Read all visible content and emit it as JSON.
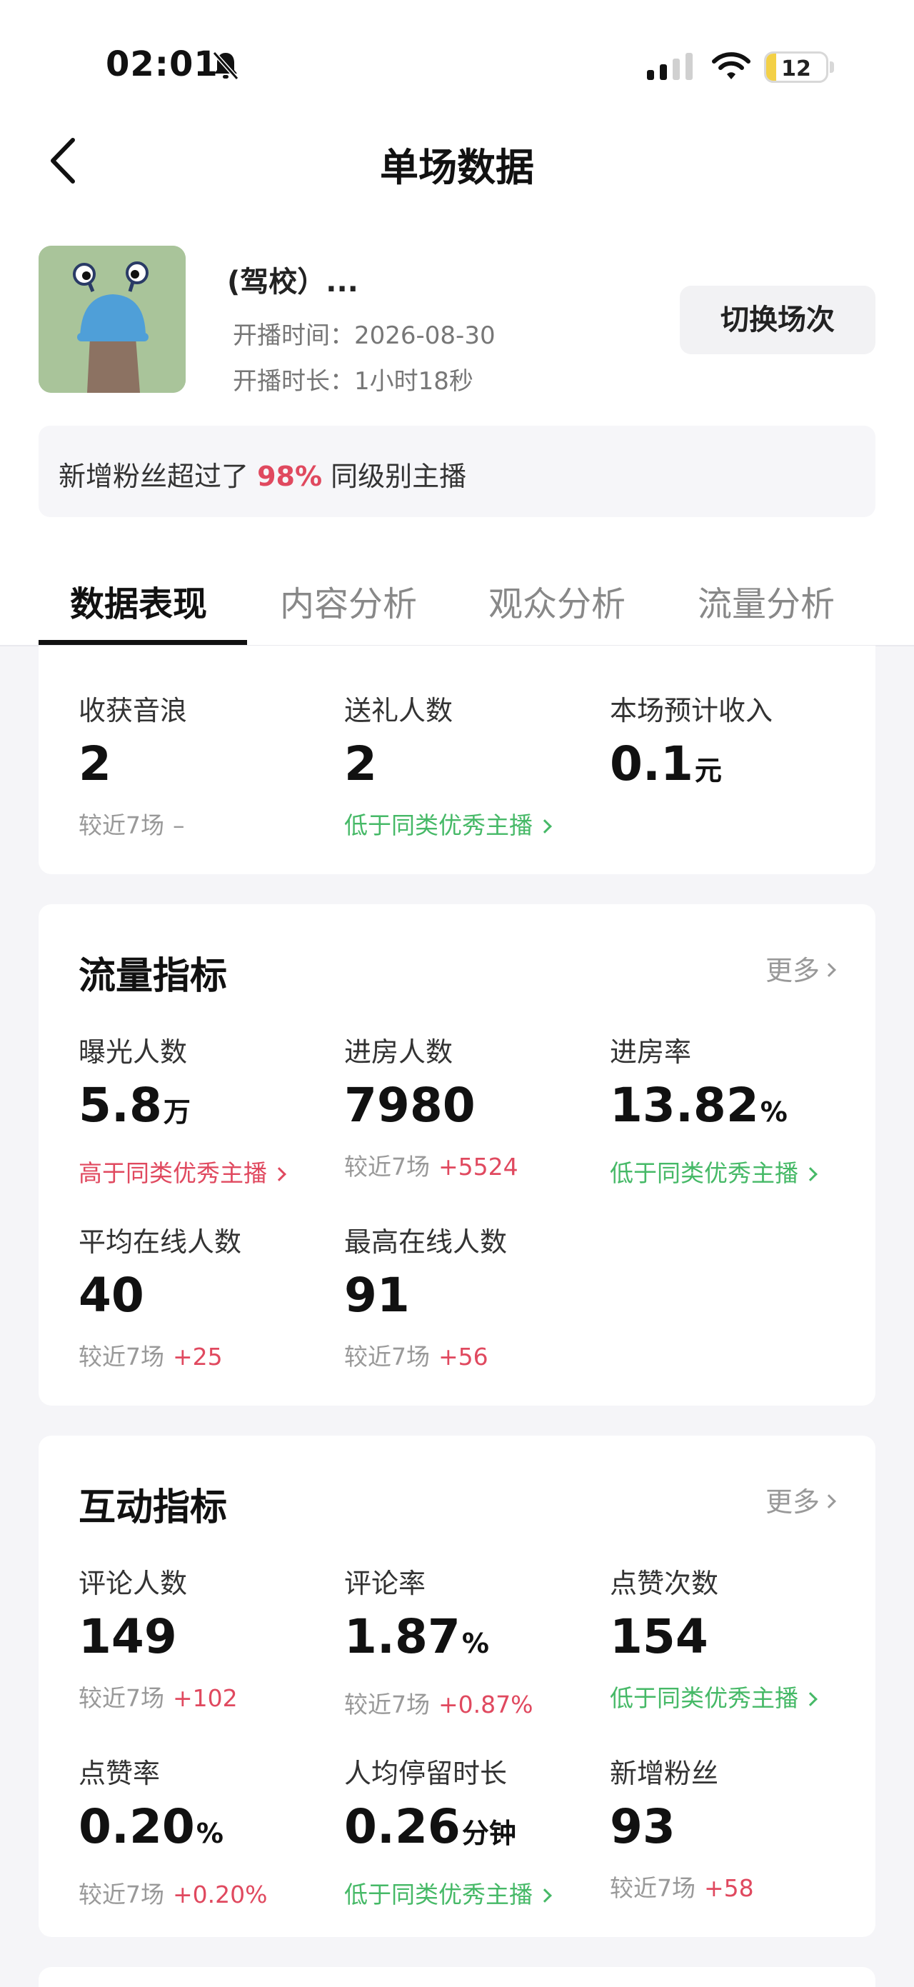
{
  "status_bar": {
    "time": "02:01",
    "battery": "12"
  },
  "header": {
    "title": "单场数据"
  },
  "room": {
    "name": "(驾校）...",
    "start_time_label": "开播时间：",
    "start_time_value": "2026-08-30",
    "duration_label": "开播时长：",
    "duration_value": "1小时18秒",
    "switch_button": "切换场次"
  },
  "banner": {
    "prefix": "新增粉丝超过了",
    "percent": "98%",
    "suffix": "同级别主播"
  },
  "tabs": [
    "数据表现",
    "内容分析",
    "观众分析",
    "流量分析"
  ],
  "summary": {
    "items": [
      {
        "label": "收获音浪",
        "value": "2",
        "unit": "",
        "sub": "较近7场",
        "delta": "–"
      },
      {
        "label": "送礼人数",
        "value": "2",
        "unit": "",
        "sub": "低于同类优秀主播"
      },
      {
        "label": "本场预计收入",
        "value": "0.1",
        "unit": "元",
        "sub": ""
      }
    ]
  },
  "traffic": {
    "title": "流量指标",
    "more": "更多",
    "items": [
      {
        "label": "曝光人数",
        "value": "5.8",
        "unit": "万",
        "sub": "高于同类优秀主播"
      },
      {
        "label": "进房人数",
        "value": "7980",
        "unit": "",
        "sub": "较近7场",
        "delta": "+5524"
      },
      {
        "label": "进房率",
        "value": "13.82",
        "unit": "%",
        "sub": "低于同类优秀主播"
      },
      {
        "label": "平均在线人数",
        "value": "40",
        "unit": "",
        "sub": "较近7场",
        "delta": "+25"
      },
      {
        "label": "最高在线人数",
        "value": "91",
        "unit": "",
        "sub": "较近7场",
        "delta": "+56"
      }
    ]
  },
  "interaction": {
    "title": "互动指标",
    "more": "更多",
    "items": [
      {
        "label": "评论人数",
        "value": "149",
        "unit": "",
        "sub": "较近7场",
        "delta": "+102"
      },
      {
        "label": "评论率",
        "value": "1.87",
        "unit": "%",
        "sub": "较近7场",
        "delta": "+0.87%"
      },
      {
        "label": "点赞次数",
        "value": "154",
        "unit": "",
        "sub": "低于同类优秀主播"
      },
      {
        "label": "点赞率",
        "value": "0.20",
        "unit": "%",
        "sub": "较近7场",
        "delta": "+0.20%"
      },
      {
        "label": "人均停留时长",
        "value": "0.26",
        "unit": "分钟",
        "sub": "低于同类优秀主播"
      },
      {
        "label": "新增粉丝",
        "value": "93",
        "unit": "",
        "sub": "较近7场",
        "delta": "+58"
      }
    ]
  },
  "colors": {
    "accent_red": "#e0495f",
    "accent_green": "#46b967",
    "battery_yellow": "#f3d046"
  }
}
